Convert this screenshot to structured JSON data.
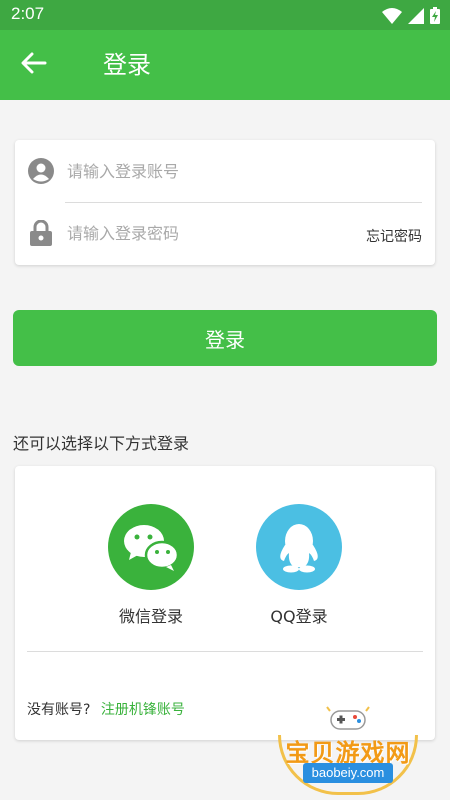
{
  "status_bar": {
    "time": "2:07",
    "icons": [
      "wifi-icon",
      "cell-signal-icon",
      "battery-charging-icon"
    ]
  },
  "app_bar": {
    "title": "登录",
    "back_icon": "arrow-left-icon",
    "color": "#44bf48"
  },
  "login_form": {
    "account": {
      "placeholder": "请输入登录账号",
      "value": "",
      "icon": "user-circle-icon"
    },
    "password": {
      "placeholder": "请输入登录密码",
      "value": "",
      "icon": "lock-icon"
    },
    "forgot_label": "忘记密码"
  },
  "login_button": {
    "label": "登录"
  },
  "alternative": {
    "label": "还可以选择以下方式登录",
    "wechat": {
      "label": "微信登录",
      "icon": "wechat-icon",
      "color": "#3ab23c"
    },
    "qq": {
      "label": "QQ登录",
      "icon": "qq-icon",
      "color": "#4bbfe3"
    }
  },
  "register": {
    "prompt": "没有账号?",
    "link": "注册机锋账号",
    "link_color": "#3ab23c"
  },
  "watermark": {
    "text": "宝贝游戏网",
    "url": "baobeiy.com"
  }
}
